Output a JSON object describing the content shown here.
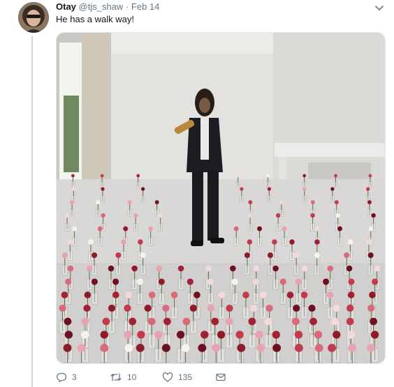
{
  "tweet": {
    "display_name": "Otay",
    "handle": "@tjs_shaw",
    "separator": "·",
    "date": "Feb 14",
    "text": "He has a walk way!"
  },
  "actions": {
    "reply_count": "3",
    "retweet_count": "10",
    "like_count": "135"
  },
  "icons": [
    "avatar",
    "chevron-down-icon",
    "reply-icon",
    "retweet-icon",
    "like-icon",
    "direct-message-icon"
  ],
  "colors": {
    "text": "#14171a",
    "muted": "#657786",
    "border": "#e1e8ed",
    "thread_line": "#ccd6dd"
  }
}
